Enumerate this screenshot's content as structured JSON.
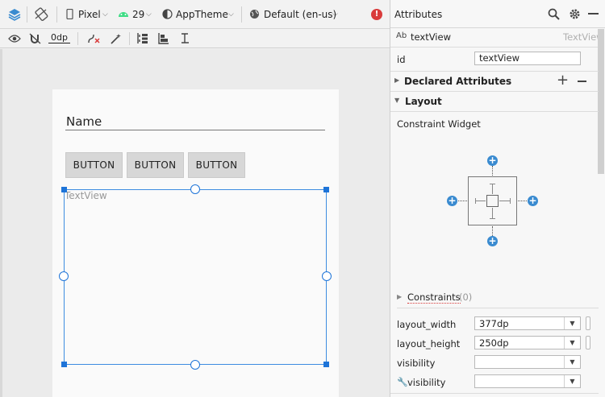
{
  "toolbar": {
    "device": "Pixel",
    "api_level": "29",
    "theme": "AppTheme",
    "locale": "Default (en-us)",
    "margin": "0dp"
  },
  "design": {
    "name_hint": "Name",
    "buttons": [
      "BUTTON",
      "BUTTON",
      "BUTTON"
    ],
    "textview_text": "TextView"
  },
  "panel": {
    "title": "Attributes",
    "component_badge": "Ab",
    "component_name": "textView",
    "component_type": "TextView",
    "id_label": "id",
    "id_value": "textView",
    "declared_attributes": "Declared Attributes",
    "layout_section": "Layout",
    "constraint_widget": "Constraint Widget",
    "constraints_label": "Constraints",
    "constraints_count": "(0)",
    "rows": [
      {
        "label": "layout_width",
        "value": "377dp"
      },
      {
        "label": "layout_height",
        "value": "250dp"
      },
      {
        "label": "visibility",
        "value": ""
      },
      {
        "label": "visibility",
        "value": ""
      }
    ]
  },
  "colors": {
    "accent": "#1e74d8",
    "error": "#d93b3b",
    "android_green": "#3ddc84"
  }
}
